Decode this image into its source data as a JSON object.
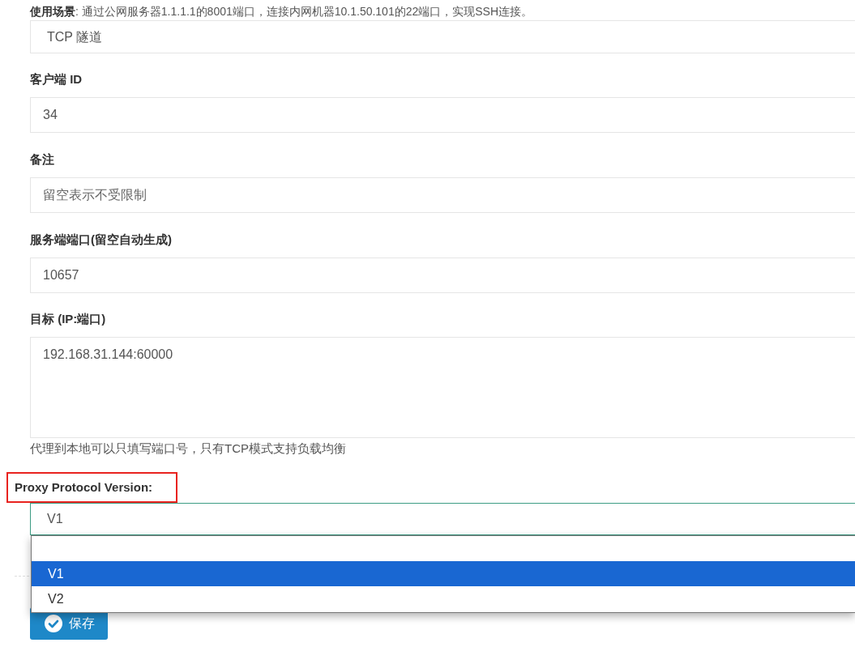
{
  "description": "**使用场景**: 通过公网服务器1.1.1.1的8001端口，连接内网机器10.1.50.101的22端口，实现SSH连接。",
  "fields": [
    {
      "kind": "select",
      "value": "TCP 隧道"
    },
    {
      "kind": "input",
      "label": "客户端 ID",
      "value": "34"
    },
    {
      "kind": "input",
      "label": "备注",
      "placeholder": "留空表示不受限制"
    },
    {
      "kind": "input",
      "label": "服务端端口(留空自动生成)",
      "value": "10657"
    },
    {
      "kind": "textarea",
      "label": "目标 (IP:端口)",
      "value": "192.168.31.144:60000",
      "hint": "代理到本地可以只填写端口号，只有TCP模式支持负载均衡"
    },
    {
      "kind": "select",
      "label": "Proxy Protocol Version:",
      "highlighted": true,
      "value": "V1",
      "focused": true,
      "open": true,
      "has_empty_option": true,
      "options": [
        {
          "label": "V1",
          "selected": true
        },
        {
          "label": "V2",
          "selected": false
        }
      ]
    }
  ],
  "save_button": {
    "label": "保存"
  }
}
